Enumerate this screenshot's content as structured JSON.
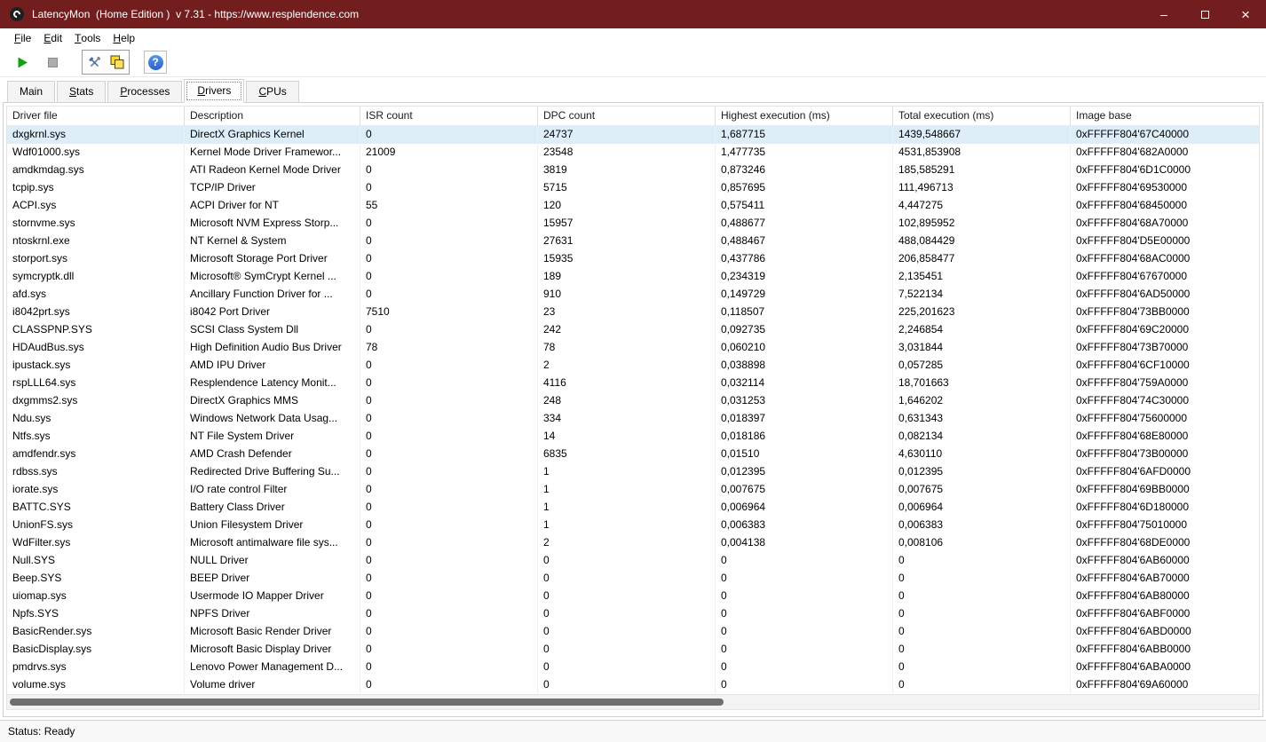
{
  "window": {
    "title": "LatencyMon  (Home Edition )  v 7.31 - https://www.resplendence.com",
    "controls": {
      "minimize_glyph": "–",
      "close_glyph": "×"
    }
  },
  "menu": {
    "items": [
      {
        "label": "File"
      },
      {
        "label": "Edit"
      },
      {
        "label": "Tools"
      },
      {
        "label": "Help"
      }
    ]
  },
  "toolbar": {
    "buttons": [
      {
        "name": "start-monitor",
        "icon": "play-icon"
      },
      {
        "name": "stop-monitor",
        "icon": "stop-icon"
      },
      {
        "name": "tools-options",
        "icon": "wrench-icon"
      },
      {
        "name": "copy-report",
        "icon": "copy-icon"
      },
      {
        "name": "help",
        "icon": "help-icon"
      }
    ],
    "help_glyph": "?"
  },
  "tabs": {
    "items": [
      {
        "label": "Main",
        "active": false
      },
      {
        "label": "Stats",
        "active": false
      },
      {
        "label": "Processes",
        "active": false
      },
      {
        "label": "Drivers",
        "active": true
      },
      {
        "label": "CPUs",
        "active": false
      }
    ],
    "active_index": 3
  },
  "table": {
    "columns": [
      "Driver file",
      "Description",
      "ISR count",
      "DPC count",
      "Highest execution (ms)",
      "Total execution (ms)",
      "Image base"
    ],
    "selected_row_index": 0,
    "rows": [
      [
        "dxgkrnl.sys",
        "DirectX Graphics Kernel",
        "0",
        "24737",
        "1,687715",
        "1439,548667",
        "0xFFFFF804'67C40000"
      ],
      [
        "Wdf01000.sys",
        "Kernel Mode Driver Framewor...",
        "21009",
        "23548",
        "1,477735",
        "4531,853908",
        "0xFFFFF804'682A0000"
      ],
      [
        "amdkmdag.sys",
        "ATI Radeon Kernel Mode Driver",
        "0",
        "3819",
        "0,873246",
        "185,585291",
        "0xFFFFF804'6D1C0000"
      ],
      [
        "tcpip.sys",
        "TCP/IP Driver",
        "0",
        "5715",
        "0,857695",
        "111,496713",
        "0xFFFFF804'69530000"
      ],
      [
        "ACPI.sys",
        "ACPI Driver for NT",
        "55",
        "120",
        "0,575411",
        "4,447275",
        "0xFFFFF804'68450000"
      ],
      [
        "stornvme.sys",
        "Microsoft NVM Express Storp...",
        "0",
        "15957",
        "0,488677",
        "102,895952",
        "0xFFFFF804'68A70000"
      ],
      [
        "ntoskrnl.exe",
        "NT Kernel & System",
        "0",
        "27631",
        "0,488467",
        "488,084429",
        "0xFFFFF804'D5E00000"
      ],
      [
        "storport.sys",
        "Microsoft Storage Port Driver",
        "0",
        "15935",
        "0,437786",
        "206,858477",
        "0xFFFFF804'68AC0000"
      ],
      [
        "symcryptk.dll",
        "Microsoft® SymCrypt Kernel ...",
        "0",
        "189",
        "0,234319",
        "2,135451",
        "0xFFFFF804'67670000"
      ],
      [
        "afd.sys",
        "Ancillary Function Driver for ...",
        "0",
        "910",
        "0,149729",
        "7,522134",
        "0xFFFFF804'6AD50000"
      ],
      [
        "i8042prt.sys",
        "i8042 Port Driver",
        "7510",
        "23",
        "0,118507",
        "225,201623",
        "0xFFFFF804'73BB0000"
      ],
      [
        "CLASSPNP.SYS",
        "SCSI Class System Dll",
        "0",
        "242",
        "0,092735",
        "2,246854",
        "0xFFFFF804'69C20000"
      ],
      [
        "HDAudBus.sys",
        "High Definition Audio Bus Driver",
        "78",
        "78",
        "0,060210",
        "3,031844",
        "0xFFFFF804'73B70000"
      ],
      [
        "ipustack.sys",
        "AMD IPU Driver",
        "0",
        "2",
        "0,038898",
        "0,057285",
        "0xFFFFF804'6CF10000"
      ],
      [
        "rspLLL64.sys",
        "Resplendence Latency Monit...",
        "0",
        "4116",
        "0,032114",
        "18,701663",
        "0xFFFFF804'759A0000"
      ],
      [
        "dxgmms2.sys",
        "DirectX Graphics MMS",
        "0",
        "248",
        "0,031253",
        "1,646202",
        "0xFFFFF804'74C30000"
      ],
      [
        "Ndu.sys",
        "Windows Network Data Usag...",
        "0",
        "334",
        "0,018397",
        "0,631343",
        "0xFFFFF804'75600000"
      ],
      [
        "Ntfs.sys",
        "NT File System Driver",
        "0",
        "14",
        "0,018186",
        "0,082134",
        "0xFFFFF804'68E80000"
      ],
      [
        "amdfendr.sys",
        "AMD Crash Defender",
        "0",
        "6835",
        "0,01510",
        "4,630110",
        "0xFFFFF804'73B00000"
      ],
      [
        "rdbss.sys",
        "Redirected Drive Buffering Su...",
        "0",
        "1",
        "0,012395",
        "0,012395",
        "0xFFFFF804'6AFD0000"
      ],
      [
        "iorate.sys",
        "I/O rate control Filter",
        "0",
        "1",
        "0,007675",
        "0,007675",
        "0xFFFFF804'69BB0000"
      ],
      [
        "BATTC.SYS",
        "Battery Class Driver",
        "0",
        "1",
        "0,006964",
        "0,006964",
        "0xFFFFF804'6D180000"
      ],
      [
        "UnionFS.sys",
        "Union Filesystem Driver",
        "0",
        "1",
        "0,006383",
        "0,006383",
        "0xFFFFF804'75010000"
      ],
      [
        "WdFilter.sys",
        "Microsoft antimalware file sys...",
        "0",
        "2",
        "0,004138",
        "0,008106",
        "0xFFFFF804'68DE0000"
      ],
      [
        "Null.SYS",
        "NULL Driver",
        "0",
        "0",
        "0",
        "0",
        "0xFFFFF804'6AB60000"
      ],
      [
        "Beep.SYS",
        "BEEP Driver",
        "0",
        "0",
        "0",
        "0",
        "0xFFFFF804'6AB70000"
      ],
      [
        "uiomap.sys",
        "Usermode IO Mapper Driver",
        "0",
        "0",
        "0",
        "0",
        "0xFFFFF804'6AB80000"
      ],
      [
        "Npfs.SYS",
        "NPFS Driver",
        "0",
        "0",
        "0",
        "0",
        "0xFFFFF804'6ABF0000"
      ],
      [
        "BasicRender.sys",
        "Microsoft Basic Render Driver",
        "0",
        "0",
        "0",
        "0",
        "0xFFFFF804'6ABD0000"
      ],
      [
        "BasicDisplay.sys",
        "Microsoft Basic Display Driver",
        "0",
        "0",
        "0",
        "0",
        "0xFFFFF804'6ABB0000"
      ],
      [
        "pmdrvs.sys",
        "Lenovo Power Management D...",
        "0",
        "0",
        "0",
        "0",
        "0xFFFFF804'6ABA0000"
      ],
      [
        "volume.sys",
        "Volume driver",
        "0",
        "0",
        "0",
        "0",
        "0xFFFFF804'69A60000"
      ]
    ]
  },
  "statusbar": {
    "text": "Status: Ready"
  },
  "colors": {
    "titlebar_bg": "#731e1e",
    "titlebar_text": "#ffffff",
    "selected_row_bg": "#ddeef9",
    "play_green": "#12a112",
    "help_blue": "#2a63c8",
    "copy_yellow": "#ffd633"
  }
}
